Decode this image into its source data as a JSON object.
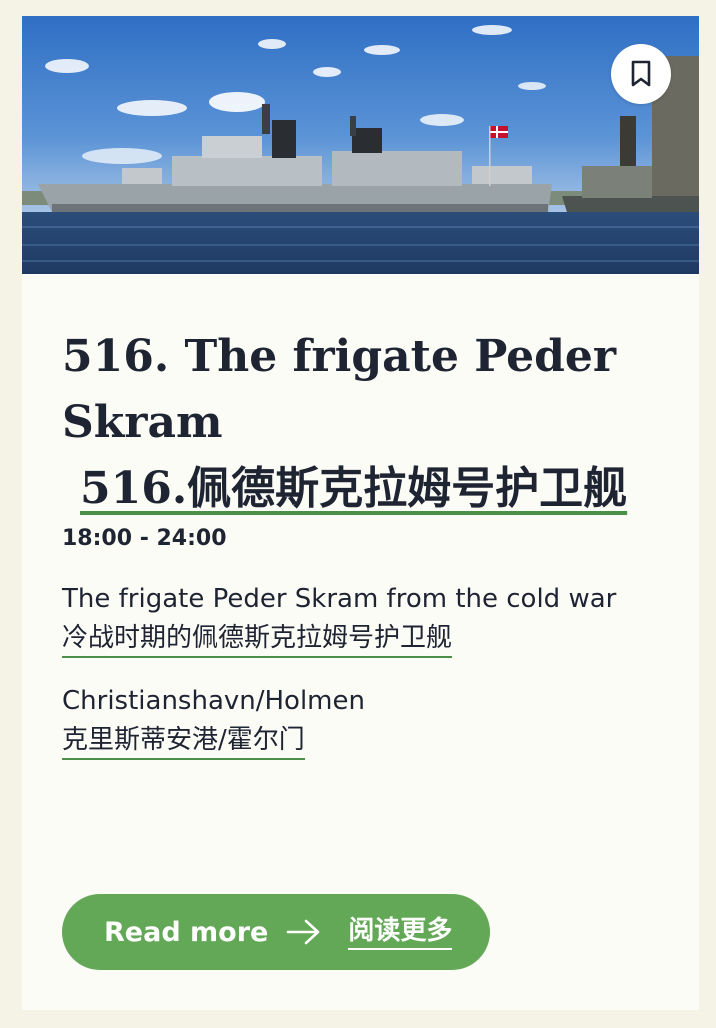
{
  "card": {
    "image_alt": "Frigate Peder Skram moored in harbour",
    "bookmark_icon": "bookmark-icon",
    "title_en": "516. The frigate Peder Skram",
    "title_zh": "516.佩德斯克拉姆号护卫舰",
    "time": "18:00 - 24:00",
    "description_en": "The frigate Peder Skram from the cold war",
    "description_zh": "冷战时期的佩德斯克拉姆号护卫舰",
    "location_en": "Christianshavn/Holmen",
    "location_zh": "克里斯蒂安港/霍尔门",
    "read_more_en": "Read more",
    "read_more_icon": "arrow-right-icon",
    "read_more_zh": "阅读更多"
  },
  "colors": {
    "page_bg": "#f5f2e6",
    "card_bg": "#fcfcf7",
    "accent_green": "#62a856",
    "underline_green": "#4a8f4a",
    "text_dark": "#1f2433"
  }
}
